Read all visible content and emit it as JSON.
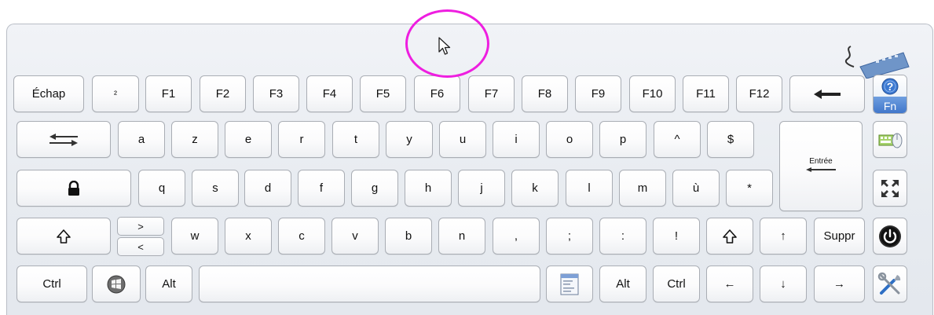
{
  "keyboard": {
    "row1": [
      "Échap",
      "²",
      "F1",
      "F2",
      "F3",
      "F4",
      "F5",
      "F6",
      "F7",
      "F8",
      "F9",
      "F10",
      "F11",
      "F12"
    ],
    "row2": [
      "a",
      "z",
      "e",
      "r",
      "t",
      "y",
      "u",
      "i",
      "o",
      "p",
      "^",
      "$"
    ],
    "row3": [
      "q",
      "s",
      "d",
      "f",
      "g",
      "h",
      "j",
      "k",
      "l",
      "m",
      "ù",
      "*"
    ],
    "row4": [
      "w",
      "x",
      "c",
      "v",
      "b",
      "n",
      ",",
      ";",
      ":",
      "!"
    ],
    "angle_top": ">",
    "angle_bottom": "<",
    "enter_label": "Entrée",
    "suppr_label": "Suppr",
    "ctrl_left": "Ctrl",
    "alt_left": "Alt",
    "alt_right": "Alt",
    "ctrl_right": "Ctrl",
    "arrow_up": "↑",
    "arrow_left": "←",
    "arrow_down": "↓",
    "arrow_right": "→",
    "fn_label": "Fn",
    "help_symbol": "?"
  },
  "colors": {
    "cursor_ring": "#ee1ee0",
    "fn_accent": "#3d73c9"
  },
  "icons": {
    "backspace": "backspace-arrow-icon",
    "tab": "tab-arrows-icon",
    "capslock": "padlock-icon",
    "shift": "shift-arrow-icon",
    "windows": "windows-logo-icon",
    "menu": "context-menu-icon",
    "options": "keyboard-mouse-icon",
    "dock": "dock-arrows-icon",
    "power": "power-icon",
    "settings": "tools-icon"
  }
}
